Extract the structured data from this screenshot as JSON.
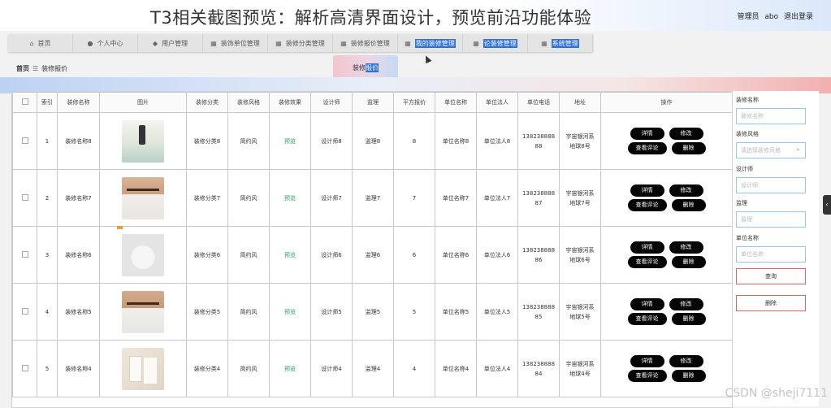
{
  "banner_title": "T3相关截图预览：解析高清界面设计，预览前沿功能体验",
  "user": {
    "role": "管理员",
    "name": "abo",
    "logout": "退出登录"
  },
  "nav": [
    {
      "label": "首页",
      "icon": "home-icon",
      "highlight": false
    },
    {
      "label": "个人中心",
      "icon": "user-icon",
      "highlight": false
    },
    {
      "label": "用户管理",
      "icon": "shield-icon",
      "highlight": false
    },
    {
      "label": "装饰单位管理",
      "icon": "grid-icon",
      "highlight": false
    },
    {
      "label": "装修分类管理",
      "icon": "grid-icon",
      "highlight": false
    },
    {
      "label": "装修报价管理",
      "icon": "grid-icon",
      "highlight": false
    },
    {
      "label": "我的装修管理",
      "icon": "grid-icon",
      "highlight": true
    },
    {
      "label": "论装修管理",
      "icon": "grid-icon",
      "highlight": true
    },
    {
      "label": "系统管理",
      "icon": "grid-icon",
      "highlight": true
    }
  ],
  "breadcrumb": {
    "home": "首页",
    "sep": "☰",
    "current": "装修报价"
  },
  "active_tab": {
    "prefix": "装修",
    "highlight": "报价"
  },
  "table": {
    "headers": [
      "",
      "索引",
      "装修名称",
      "图片",
      "装修分类",
      "装修风格",
      "装修效果",
      "设计师",
      "监理",
      "平方报价",
      "单位名称",
      "单位法人",
      "单位电话",
      "地址",
      "操作"
    ],
    "rows": [
      {
        "index": "1",
        "name": "装修名称8",
        "img": "img1",
        "category": "装修分类8",
        "style": "简约风",
        "effect": "预览",
        "designer": "设计师8",
        "supervisor": "监理8",
        "price": "8",
        "unit": "单位名称8",
        "legal": "单位法人8",
        "phone1": "138238888",
        "phone2": "88",
        "addr1": "宇宙银河系",
        "addr2": "地球8号"
      },
      {
        "index": "2",
        "name": "装修名称7",
        "img": "img2",
        "category": "装修分类7",
        "style": "简约风",
        "effect": "预览",
        "designer": "设计师7",
        "supervisor": "监理7",
        "price": "7",
        "unit": "单位名称7",
        "legal": "单位法人7",
        "phone1": "138238888",
        "phone2": "87",
        "addr1": "宇宙银河系",
        "addr2": "地球7号"
      },
      {
        "index": "3",
        "name": "装修名称6",
        "img": "img3",
        "category": "装修分类6",
        "style": "简约风",
        "effect": "预览",
        "designer": "设计师6",
        "supervisor": "监理6",
        "price": "6",
        "unit": "单位名称6",
        "legal": "单位法人6",
        "phone1": "138238888",
        "phone2": "86",
        "addr1": "宇宙银河系",
        "addr2": "地球6号"
      },
      {
        "index": "4",
        "name": "装修名称5",
        "img": "img4",
        "category": "装修分类5",
        "style": "简约风",
        "effect": "预览",
        "designer": "设计师5",
        "supervisor": "监理5",
        "price": "5",
        "unit": "单位名称5",
        "legal": "单位法人5",
        "phone1": "138238888",
        "phone2": "85",
        "addr1": "宇宙银河系",
        "addr2": "地球5号"
      },
      {
        "index": "5",
        "name": "装修名称4",
        "img": "img5",
        "category": "装修分类4",
        "style": "简约风",
        "effect": "预览",
        "designer": "设计师4",
        "supervisor": "监理4",
        "price": "4",
        "unit": "单位名称4",
        "legal": "单位法人4",
        "phone1": "138238888",
        "phone2": "84",
        "addr1": "宇宙银河系",
        "addr2": "地球4号"
      }
    ],
    "actions": {
      "detail": "详情",
      "edit": "修改",
      "comments": "查看评论",
      "delete": "删除"
    }
  },
  "sidebar": {
    "name_label": "装修名称",
    "name_placeholder": "装修名称",
    "style_label": "装修风格",
    "style_placeholder": "请选择装修风格",
    "designer_label": "设计师",
    "designer_placeholder": "设计师",
    "supervisor_label": "监理",
    "supervisor_placeholder": "监理",
    "unit_label": "单位名称",
    "unit_placeholder": "单位名称",
    "query_button": "查询",
    "delete_button": "删除"
  },
  "watermark": "CSDN @sheji7111"
}
